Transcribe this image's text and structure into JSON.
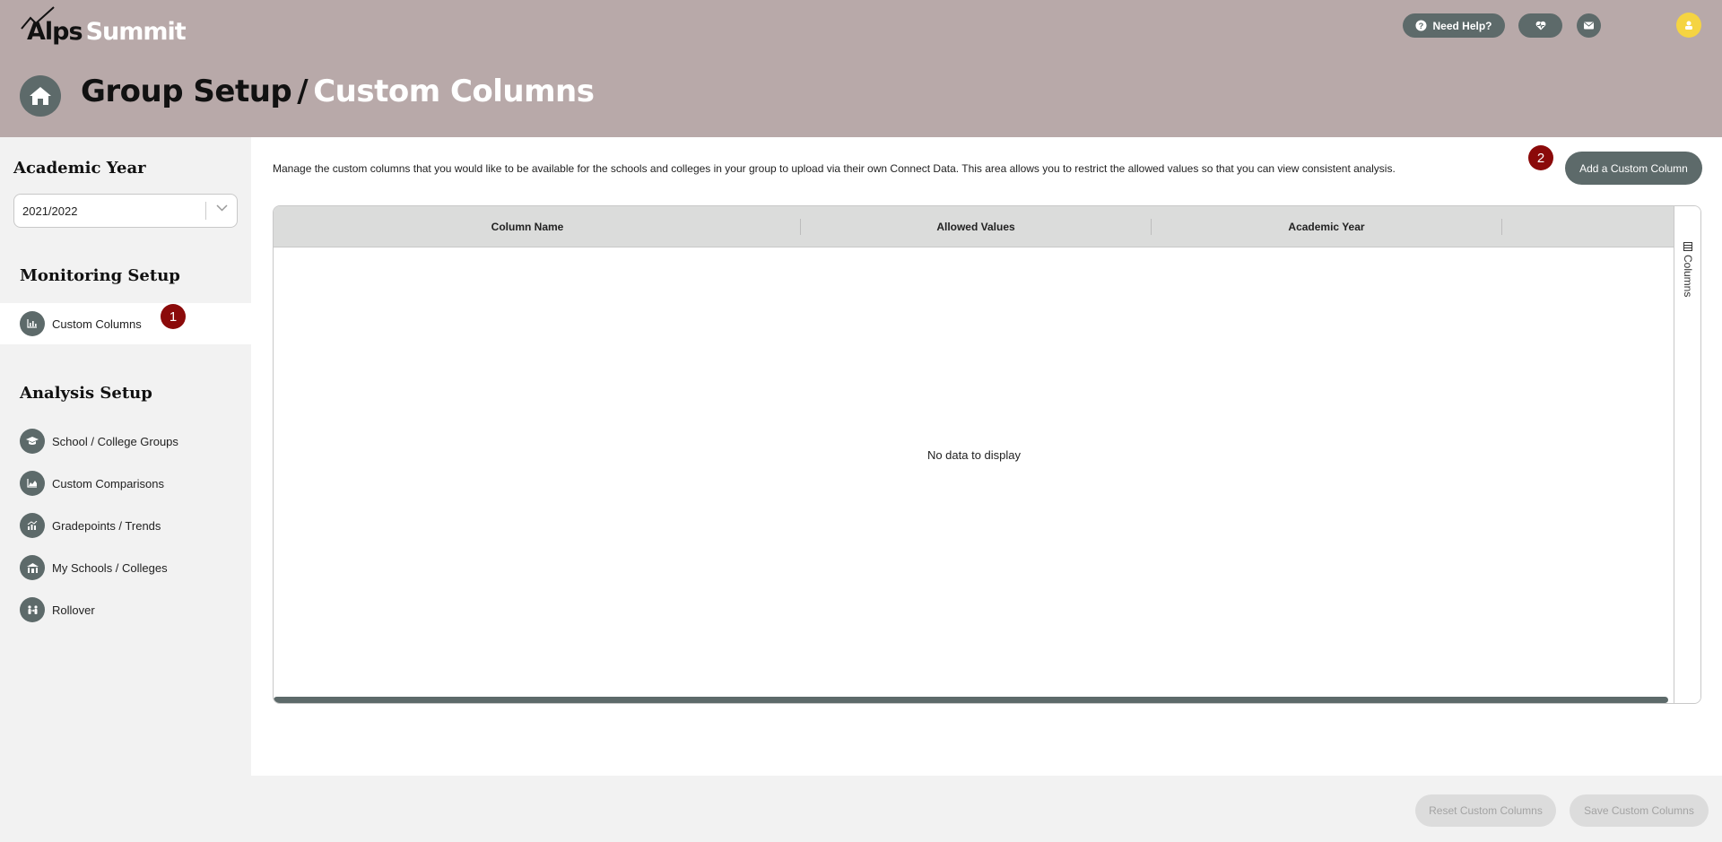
{
  "app": {
    "logo_alps": "Alps",
    "logo_summit": "Summit"
  },
  "header": {
    "help_label": "Need Help?",
    "breadcrumb_parent": "Group Setup",
    "breadcrumb_separator": "/",
    "breadcrumb_current": "Custom Columns"
  },
  "sidebar": {
    "academic_year_heading": "Academic Year",
    "academic_year_value": "2021/2022",
    "monitoring_heading": "Monitoring Setup",
    "monitoring_items": [
      {
        "label": "Custom Columns",
        "icon": "chart-bar-icon",
        "active": true
      }
    ],
    "analysis_heading": "Analysis Setup",
    "analysis_items": [
      {
        "label": "School / College Groups",
        "icon": "graduation-cap-icon"
      },
      {
        "label": "Custom Comparisons",
        "icon": "area-chart-icon"
      },
      {
        "label": "Gradepoints / Trends",
        "icon": "trend-chart-icon"
      },
      {
        "label": "My Schools / Colleges",
        "icon": "school-building-icon"
      },
      {
        "label": "Rollover",
        "icon": "rollover-people-icon"
      }
    ]
  },
  "main": {
    "intro_text": "Manage the custom columns that you would like to be available for the schools and colleges in your group to upload via their own Connect Data. This area allows you to restrict the allowed values so that you can view consistent analysis.",
    "add_button": "Add a Custom Column",
    "grid": {
      "columns": [
        "Column Name",
        "Allowed Values",
        "Academic Year"
      ],
      "empty_text": "No data to display",
      "side_panel_label": "Columns"
    }
  },
  "badges": {
    "step1": "1",
    "step2": "2"
  },
  "footer": {
    "reset_label": "Reset Custom Columns",
    "save_label": "Save Custom Columns"
  },
  "colors": {
    "header_bg": "#b8a9a9",
    "accent": "#5d6a6a",
    "badge": "#8b0a0a",
    "avatar": "#f5d442"
  }
}
